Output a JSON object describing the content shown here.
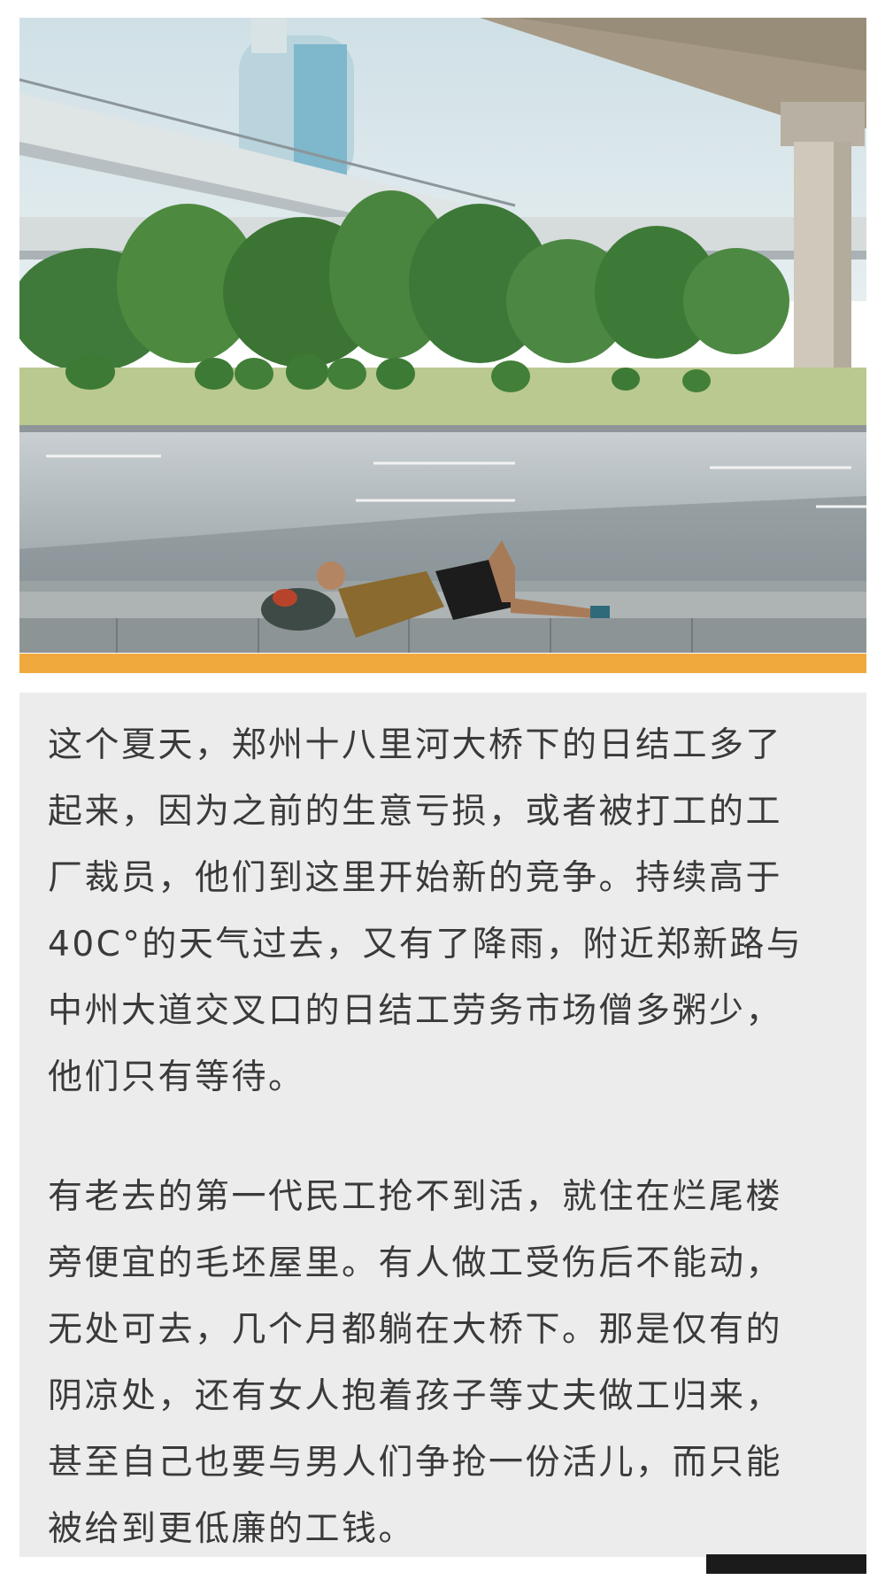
{
  "photo": {
    "alt_subject": "man-lying-under-bridge"
  },
  "colors": {
    "accent": "#f0a93c",
    "card_background": "#ececec",
    "text": "#3a3a3a",
    "corner_bar": "#1b1b1b"
  },
  "article": {
    "paragraph_1": [
      "这个夏天，郑州十八里河大桥下的日结工多了",
      "起来，因为之前的生意亏损，或者被打工的工",
      "厂裁员，他们到这里开始新的竞争。持续高于",
      "40C°的天气过去，又有了降雨，附近郑新路与",
      "中州大道交叉口的日结工劳务市场僧多粥少，",
      "他们只有等待。"
    ],
    "paragraph_2": [
      "有老去的第一代民工抢不到活，就住在烂尾楼",
      "旁便宜的毛坯屋里。有人做工受伤后不能动，",
      "无处可去，几个月都躺在大桥下。那是仅有的",
      "阴凉处，还有女人抱着孩子等丈夫做工归来，",
      "甚至自己也要与男人们争抢一份活儿，而只能",
      "被给到更低廉的工钱。"
    ]
  }
}
